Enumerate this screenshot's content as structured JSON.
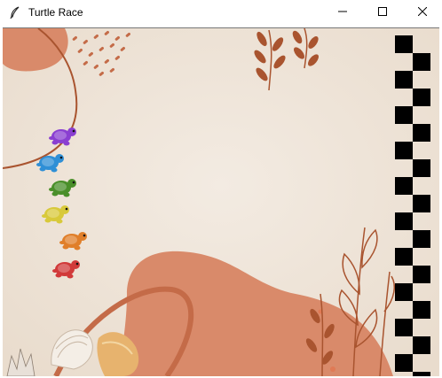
{
  "window": {
    "title": "Turtle Race",
    "icons": {
      "app": "feather-icon",
      "minimize": "minimize-icon",
      "maximize": "maximize-icon",
      "close": "close-icon"
    }
  },
  "race": {
    "turtles": [
      {
        "color": "purple",
        "hex": "#8a3fd1"
      },
      {
        "color": "blue",
        "hex": "#2f8fd6"
      },
      {
        "color": "green",
        "hex": "#4a8f2a"
      },
      {
        "color": "yellow",
        "hex": "#d8c93a"
      },
      {
        "color": "orange",
        "hex": "#e07f2a"
      },
      {
        "color": "red",
        "hex": "#d13a3a"
      }
    ],
    "finish_line": "checkered-flag",
    "colors": {
      "sand": "#efe3d6",
      "terracotta": "#d98a6a",
      "leaf": "#a9542f",
      "checker": "#000000"
    }
  }
}
